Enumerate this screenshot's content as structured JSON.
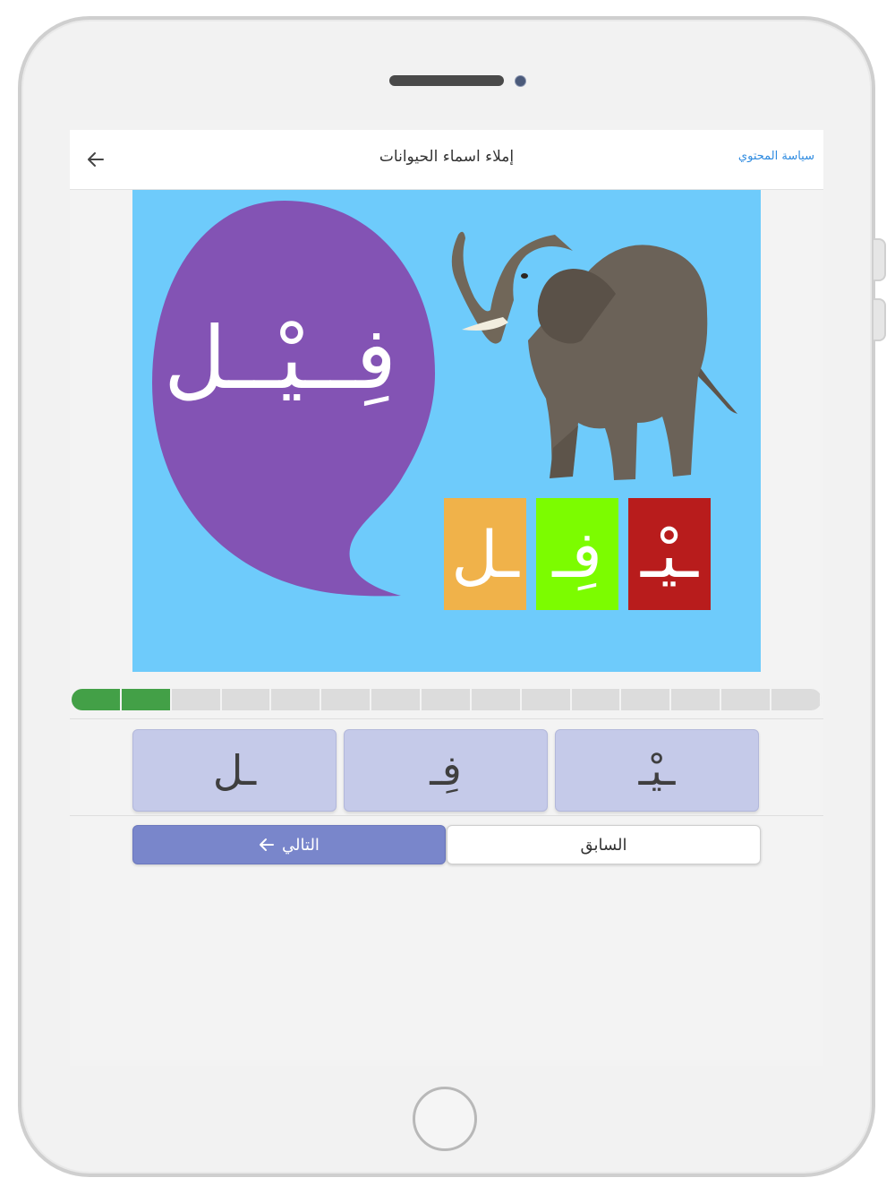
{
  "device": {
    "speaker_icon": "speaker-slot",
    "camera_icon": "front-camera",
    "home_icon": "home-button"
  },
  "header": {
    "title": "إملاء اسماء الحيوانات",
    "policy_link": "سياسة المحتوي",
    "back_icon": "arrow-left-icon"
  },
  "lesson": {
    "word": "فِــيْــل",
    "illustration": "elephant",
    "tiles": [
      {
        "letter": "ـيْـ",
        "color": "#b81c1c"
      },
      {
        "letter": "فِـ",
        "color": "#7cfc00"
      },
      {
        "letter": "ـل",
        "color": "#f0b24a"
      }
    ],
    "bubble_color": "#8353b4",
    "background": "#6ecbfb"
  },
  "progress": {
    "completed": 2,
    "total": 15,
    "color": "#43a047"
  },
  "answer_buttons": [
    {
      "letter": "ـيْـ"
    },
    {
      "letter": "فِـ"
    },
    {
      "letter": "ـل"
    }
  ],
  "nav": {
    "next_label": "التالي",
    "next_icon": "arrow-left-icon",
    "prev_label": "السابق"
  }
}
